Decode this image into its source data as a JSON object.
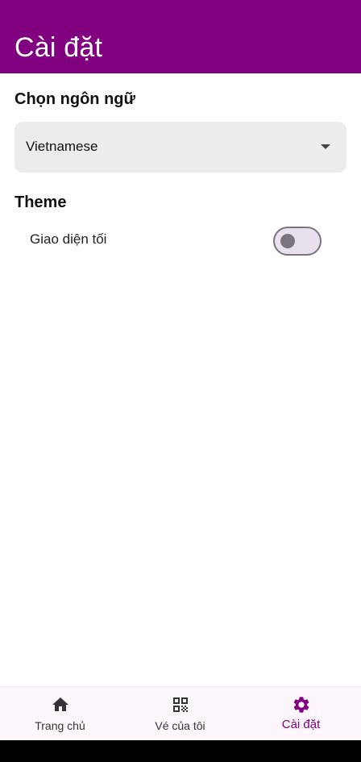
{
  "appbar": {
    "title": "Cài đặt",
    "color": "#800080"
  },
  "language": {
    "label": "Chọn ngôn ngữ",
    "selected": "Vietnamese",
    "icon": "dropdown-arrow-icon"
  },
  "theme": {
    "label": "Theme",
    "dark_mode_label": "Giao diện tối",
    "dark_mode_on": false
  },
  "bottom_nav": {
    "items": [
      {
        "label": "Trang chủ",
        "icon": "home-icon",
        "active": false
      },
      {
        "label": "Vé của tôi",
        "icon": "qr-code-icon",
        "active": false
      },
      {
        "label": "Cài đặt",
        "icon": "gear-icon",
        "active": true
      }
    ],
    "active_color": "#800080"
  }
}
